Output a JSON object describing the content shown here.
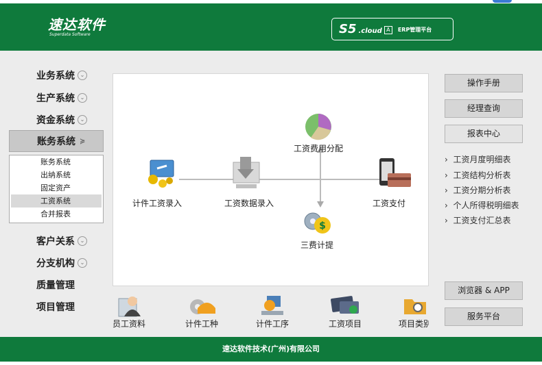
{
  "header": {
    "logo_cn": "速达软件",
    "logo_en": "Superdata Software",
    "brand_s5": "S5",
    "brand_cloud": ".cloud",
    "brand_badge": "A",
    "brand_erp": "ERP管理平台"
  },
  "sidebar": {
    "items": [
      {
        "label": "业务系统"
      },
      {
        "label": "生产系统"
      },
      {
        "label": "资金系统"
      },
      {
        "label": "账务系统"
      },
      {
        "label": "客户关系"
      },
      {
        "label": "分支机构"
      },
      {
        "label": "质量管理"
      },
      {
        "label": "项目管理"
      }
    ],
    "submenu": [
      "账务系统",
      "出纳系统",
      "固定资产",
      "工资系统",
      "合并报表"
    ]
  },
  "flow": {
    "nodes": {
      "piece_wage_entry": "计件工资录入",
      "wage_data_entry": "工资数据录入",
      "wage_cost_allocation": "工资费用分配",
      "three_fees": "三费计提",
      "wage_payment": "工资支付"
    }
  },
  "bottom_icons": [
    "员工资料",
    "计件工种",
    "计件工序",
    "工资项目",
    "项目类别"
  ],
  "right": {
    "buttons": [
      "操作手册",
      "经理查询",
      "报表中心"
    ],
    "links": [
      "工资月度明细表",
      "工资结构分析表",
      "工资分期分析表",
      "个人所得税明细表",
      "工资支付汇总表"
    ],
    "bottom_buttons": [
      "浏览器 & APP",
      "服务平台"
    ]
  },
  "footer": {
    "company": "速达软件技术(广州)有限公司"
  },
  "colors": {
    "brand_green": "#0f7a3c",
    "panel_bg": "#ececec"
  }
}
